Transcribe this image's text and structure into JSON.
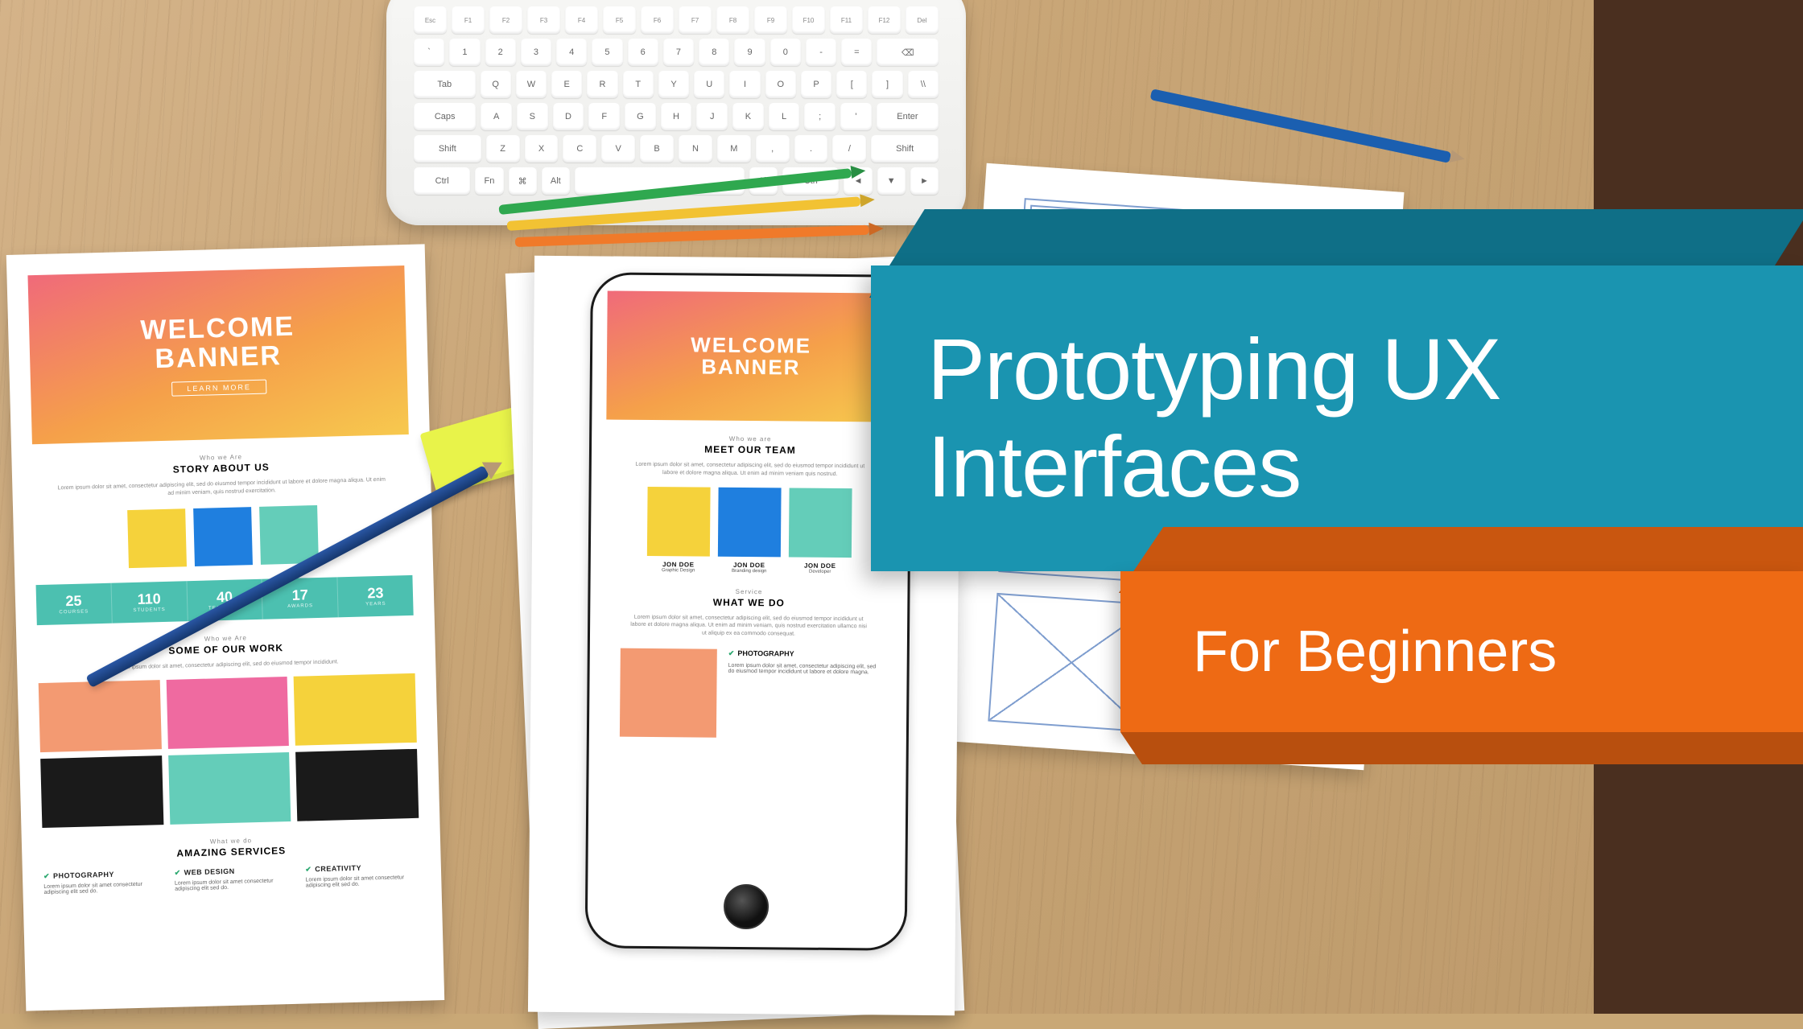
{
  "title": {
    "main": "Prototyping UX Interfaces",
    "subtitle": "For Beginners"
  },
  "colors": {
    "teal": "#1a94b0",
    "teal_dark": "#0f6f87",
    "orange": "#ee6a14",
    "orange_dark": "#b84f0e",
    "brown_panel": "#4a2f1f"
  },
  "mockup_left": {
    "banner_line1": "WELCOME",
    "banner_line2": "BANNER",
    "section_eyebrow": "Who we Are",
    "section1_title": "STORY ABOUT US",
    "lorem": "Lorem ipsum dolor sit amet, consectetur adipiscing elit, sed do eiusmod tempor incididunt ut labore et dolore magna aliqua. Ut enim ad minim veniam, quis nostrud exercitation.",
    "swatches": [
      "#f5d23b",
      "#1f7fdf",
      "#64cdb9"
    ],
    "stats": [
      {
        "value": "25",
        "label": "COURSES"
      },
      {
        "value": "110",
        "label": "STUDENTS"
      },
      {
        "value": "40",
        "label": "TEACHERS"
      },
      {
        "value": "17",
        "label": "AWARDS"
      },
      {
        "value": "23",
        "label": "YEARS"
      }
    ],
    "section2_title": "SOME OF OUR WORK",
    "work_colors": [
      "#f39a72",
      "#ef6aa0",
      "#f5d23b",
      "#1a1a1a",
      "#64cdb9",
      "#1a1a1a"
    ],
    "section3_title": "AMAZING SERVICES",
    "services": [
      {
        "name": "PHOTOGRAPHY"
      },
      {
        "name": "WEB DESIGN"
      },
      {
        "name": "CREATIVITY"
      }
    ]
  },
  "mockup_phone": {
    "banner_line1": "WELCOME",
    "banner_line2": "BANNER",
    "section1_eyebrow": "Who we are",
    "section1_title": "MEET OUR TEAM",
    "lorem": "Lorem ipsum dolor sit amet, consectetur adipiscing elit, sed do eiusmod tempor incididunt ut labore et dolore magna aliqua. Ut enim ad minim veniam quis nostrud.",
    "team": [
      {
        "name": "JON DOE",
        "role": "Graphic Design",
        "color": "#f5d23b"
      },
      {
        "name": "JON DOE",
        "role": "Branding design",
        "color": "#1f7fdf"
      },
      {
        "name": "JON DOE",
        "role": "Developer",
        "color": "#64cdb9"
      }
    ],
    "section2_eyebrow": "Service",
    "section2_title": "WHAT WE DO",
    "lorem2": "Lorem ipsum dolor sit amet, consectetur adipiscing elit, sed do eiusmod tempor incididunt ut labore et dolore magna aliqua. Ut enim ad minim veniam, quis nostrud exercitation ullamco nisi ut aliquip ex ea commodo consequat.",
    "feature_label": "PHOTOGRAPHY"
  },
  "keyboard_rows": [
    [
      "Esc",
      "F1",
      "F2",
      "F3",
      "F4",
      "F5",
      "F6",
      "F7",
      "F8",
      "F9",
      "F10",
      "F11",
      "F12",
      "Del"
    ],
    [
      "`",
      "1",
      "2",
      "3",
      "4",
      "5",
      "6",
      "7",
      "8",
      "9",
      "0",
      "-",
      "=",
      "⌫"
    ],
    [
      "Tab",
      "Q",
      "W",
      "E",
      "R",
      "T",
      "Y",
      "U",
      "I",
      "O",
      "P",
      "[",
      "]",
      "\\\\"
    ],
    [
      "Caps",
      "A",
      "S",
      "D",
      "F",
      "G",
      "H",
      "J",
      "K",
      "L",
      ";",
      "'",
      "Enter"
    ],
    [
      "Shift",
      "Z",
      "X",
      "C",
      "V",
      "B",
      "N",
      "M",
      ",",
      ".",
      "/",
      "Shift"
    ],
    [
      "Ctrl",
      "Fn",
      "⌘",
      "Alt",
      "",
      "Alt",
      "Ctrl",
      "◄",
      "▼",
      "►"
    ]
  ]
}
